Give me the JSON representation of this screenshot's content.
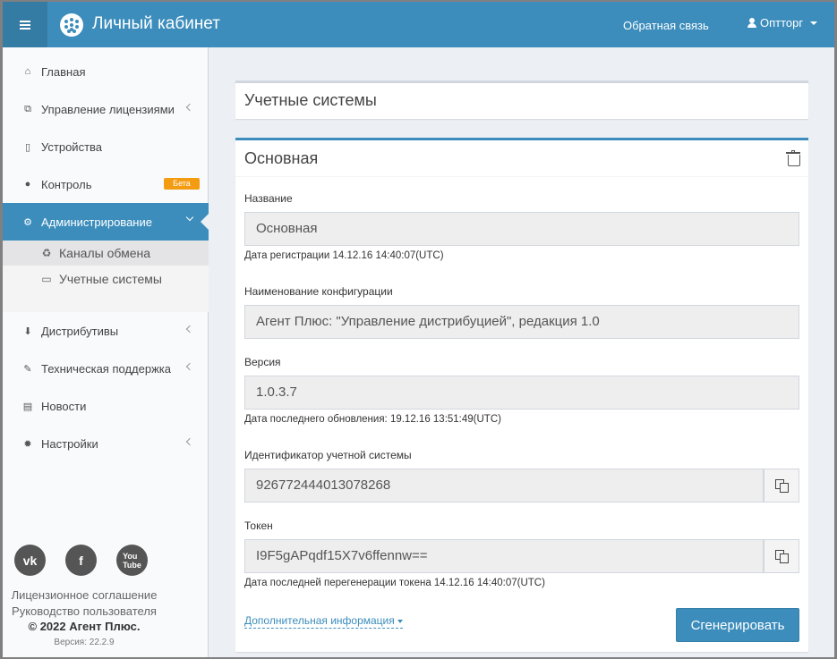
{
  "header": {
    "menu_icon": "hamburger-icon",
    "logo_icon": "logo-icon",
    "title": "Личный кабинет",
    "feedback": "Обратная связь",
    "user": "Оптторг"
  },
  "sidebar": {
    "items": [
      {
        "label": "Главная",
        "icon": "home-icon"
      },
      {
        "label": "Управление лицензиями",
        "icon": "sitemap-icon"
      },
      {
        "label": "Устройства",
        "icon": "mobile-icon"
      },
      {
        "label": "Контроль",
        "icon": "globe-icon",
        "badge": "Бета"
      },
      {
        "label": "Администрирование",
        "icon": "cogs-icon"
      },
      {
        "label": "Дистрибутивы",
        "icon": "download-icon"
      },
      {
        "label": "Техническая поддержка",
        "icon": "wrench-icon"
      },
      {
        "label": "Новости",
        "icon": "newspaper-icon"
      },
      {
        "label": "Настройки",
        "icon": "gear-icon"
      }
    ],
    "subitems": [
      {
        "label": "Каналы обмена",
        "icon": "recycle-icon"
      },
      {
        "label": "Учетные системы",
        "icon": "desktop-icon"
      }
    ],
    "socials": [
      "vk-icon",
      "facebook-icon",
      "youtube-icon"
    ],
    "license": "Лицензионное соглашение",
    "guide": "Руководство пользователя",
    "copyright": "© 2022 Агент Плюс.",
    "version": "Версия: 22.2.9"
  },
  "main": {
    "page_title": "Учетные системы",
    "box_title": "Основная",
    "name_label": "Название",
    "name_value": "Основная",
    "reg_date": "Дата регистрации 14.12.16 14:40:07(UTC)",
    "config_label": "Наименование конфигурации",
    "config_value": "Агент Плюс: \"Управление дистрибуцией\", редакция 1.0",
    "version_label": "Версия",
    "version_value": "1.0.3.7",
    "update_date": "Дата последнего обновления: 19.12.16 13:51:49(UTC)",
    "id_label": "Идентификатор учетной системы",
    "id_value": "926772444013078268",
    "token_label": "Токен",
    "token_value": "I9F5gAPqdf15X7v6ffennw==",
    "regen_date": "Дата последней перегенерации токена 14.12.16 14:40:07(UTC)",
    "more_info": "Дополнительная информация",
    "generate_button": "Сгенерировать"
  }
}
